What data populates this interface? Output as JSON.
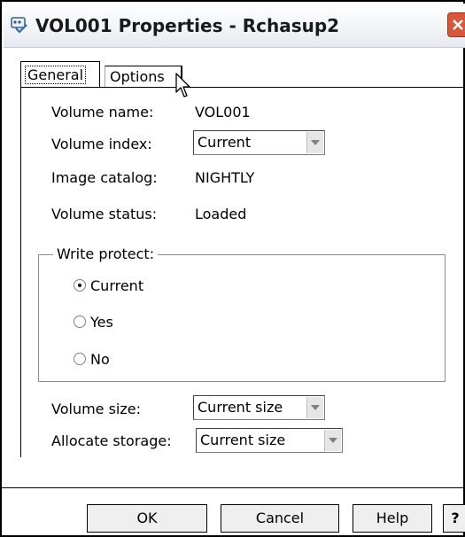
{
  "window": {
    "title": "VOL001 Properties - Rchasup2"
  },
  "tabs": [
    {
      "label": "General",
      "active": true
    },
    {
      "label": "Options",
      "active": false
    }
  ],
  "general": {
    "volume_name_label": "Volume name:",
    "volume_name_value": "VOL001",
    "volume_index_label": "Volume index:",
    "volume_index_selected": "Current",
    "image_catalog_label": "Image catalog:",
    "image_catalog_value": "NIGHTLY",
    "volume_status_label": "Volume status:",
    "volume_status_value": "Loaded",
    "write_protect": {
      "title": "Write protect:",
      "options": [
        {
          "label": "Current",
          "checked": true
        },
        {
          "label": "Yes",
          "checked": false
        },
        {
          "label": "No",
          "checked": false
        }
      ]
    },
    "volume_size_label": "Volume size:",
    "volume_size_selected": "Current size",
    "allocate_storage_label": "Allocate storage:",
    "allocate_storage_selected": "Current size"
  },
  "buttons": {
    "ok": "OK",
    "cancel": "Cancel",
    "help": "Help",
    "whats_this": "?"
  },
  "icons": {
    "app": "storage-properties-icon",
    "close": "close-icon",
    "cursor": "mouse-pointer-icon"
  },
  "colors": {
    "close_button": "#d8563a",
    "title_text": "#1a1a1a"
  }
}
